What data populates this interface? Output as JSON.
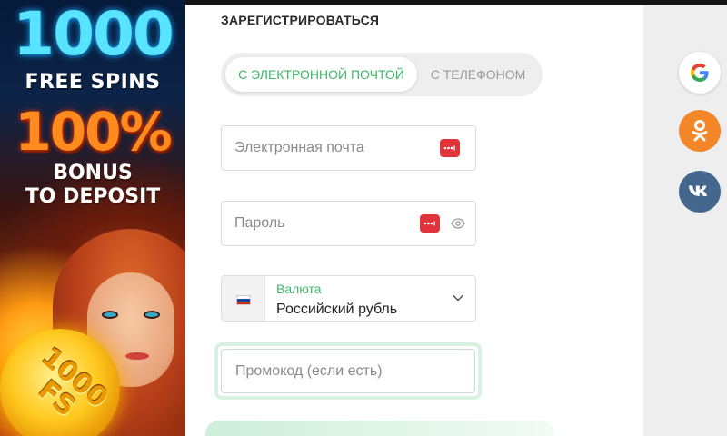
{
  "promo": {
    "line1": "1000",
    "line2": "FREE SPINS",
    "line3": "100%",
    "line4": "BONUS",
    "line5": "TO DEPOSIT",
    "coin_line1": "1000",
    "coin_line2": "FS"
  },
  "form": {
    "title": "ЗАРЕГИСТРИРОВАТЬСЯ",
    "tabs": [
      {
        "label": "С ЭЛЕКТРОННОЙ ПОЧТОЙ",
        "active": true
      },
      {
        "label": "С ТЕЛЕФОНОМ",
        "active": false
      }
    ],
    "email": {
      "placeholder": "Электронная почта",
      "value": ""
    },
    "password": {
      "placeholder": "Пароль",
      "value": ""
    },
    "currency": {
      "label": "Валюта",
      "value": "Российский рубль"
    },
    "promo_code": {
      "placeholder": "Промокод (если есть)",
      "value": ""
    }
  },
  "social": [
    {
      "icon": "google-icon"
    },
    {
      "icon": "odnoklassniki-icon"
    },
    {
      "icon": "vk-icon"
    }
  ],
  "colors": {
    "accent_green": "#3db86a",
    "password_manager_red": "#e0343a",
    "ok_orange": "#f4862a",
    "vk_blue": "#44678e"
  }
}
